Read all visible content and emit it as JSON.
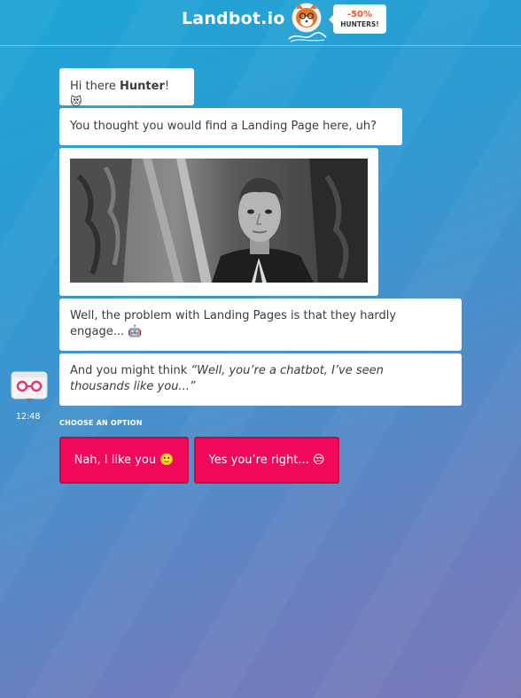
{
  "header": {
    "brand": "Landbot.io",
    "promo_percent": "-50%",
    "promo_label": "HUNTERS!"
  },
  "chat": {
    "messages": [
      {
        "greeting_pre": "Hi there ",
        "greeting_name": "Hunter",
        "greeting_post": "! ",
        "emoji": "😻"
      },
      {
        "text": "You thought you would find a Landing Page here, uh?"
      },
      {
        "type": "gif"
      },
      {
        "line1": "Well, the problem with Landing Pages is that they hardly",
        "line2": "engage... ",
        "emoji": "🤖"
      },
      {
        "text_pre": "And you might think ",
        "quote_line1": "“Well, you’re a chatbot, I’ve seen",
        "quote_line2": "thousands like you...”"
      }
    ],
    "timestamp": "12:48",
    "choose_label": "CHOOSE AN OPTION",
    "options": [
      {
        "label": "Nah, I like you ",
        "emoji": "🙂"
      },
      {
        "label": "Yes you’re right... ",
        "emoji": "😒"
      }
    ]
  },
  "colors": {
    "option_bg": "#f2085a",
    "bubble_bg": "#ffffff",
    "gradient_top": "#1fa6d6",
    "gradient_bottom": "#7a78b8"
  },
  "icons": {
    "bot_avatar": "robot-glasses-icon",
    "producthunt_logo": "producthunt-kitty-icon"
  }
}
